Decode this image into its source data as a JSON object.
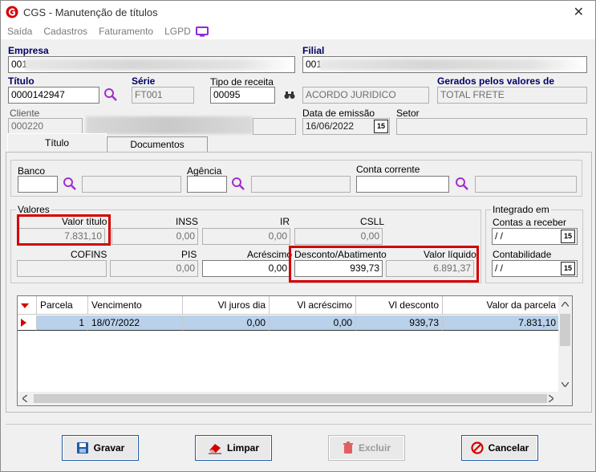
{
  "window": {
    "title": "CGS - Manutenção de títulos",
    "accent": "#d40000"
  },
  "menu": [
    "Saída",
    "Cadastros",
    "Faturamento",
    "LGPD"
  ],
  "empresa": {
    "label": "Empresa",
    "value": "001"
  },
  "filial": {
    "label": "Filial",
    "value": "001"
  },
  "titulo": {
    "label": "Título",
    "value": "0000142947"
  },
  "serie": {
    "label": "Série",
    "value": "FT001"
  },
  "tipo_receita": {
    "label": "Tipo de receita",
    "value": "00095",
    "description": "ACORDO JURIDICO"
  },
  "gerados": {
    "label": "Gerados pelos valores de",
    "value": "TOTAL FRETE"
  },
  "cliente": {
    "label": "Cliente",
    "value": "000220"
  },
  "data_emissao": {
    "label": "Data de emissão",
    "value": "16/06/2022"
  },
  "setor": {
    "label": "Setor",
    "value": ""
  },
  "tabs": [
    "Título",
    "Documentos"
  ],
  "banco": {
    "label": "Banco"
  },
  "agencia": {
    "label": "Agência"
  },
  "conta": {
    "label": "Conta corrente"
  },
  "valores": {
    "title": "Valores",
    "valor_titulo": {
      "label": "Valor título",
      "value": "7.831,10"
    },
    "inss": {
      "label": "INSS",
      "value": "0,00"
    },
    "ir": {
      "label": "IR",
      "value": "0,00"
    },
    "csll": {
      "label": "CSLL",
      "value": "0,00"
    },
    "cofins": {
      "label": "COFINS",
      "value": ""
    },
    "pis": {
      "label": "PIS",
      "value": "0,00"
    },
    "acrescimo": {
      "label": "Acréscimo",
      "value": "0,00"
    },
    "desconto": {
      "label": "Desconto/Abatimento",
      "value": "939,73"
    },
    "liquido": {
      "label": "Valor líquido",
      "value": "6.891,37"
    }
  },
  "integrado": {
    "title": "Integrado em",
    "contas_receber": {
      "label": "Contas a receber",
      "value": " / /"
    },
    "contabilidade": {
      "label": "Contabilidade",
      "value": " / /"
    }
  },
  "grid": {
    "headers": [
      "Parcela",
      "Vencimento",
      "Vl juros dia",
      "Vl acréscimo",
      "Vl desconto",
      "Valor da parcela"
    ],
    "rows": [
      {
        "parcela": "1",
        "vencimento": "18/07/2022",
        "juros": "0,00",
        "acrescimo": "0,00",
        "desconto": "939,73",
        "valor": "7.831,10"
      }
    ]
  },
  "buttons": {
    "gravar": "Gravar",
    "limpar": "Limpar",
    "excluir": "Excluir",
    "cancelar": "Cancelar"
  },
  "calendar_glyph": "15"
}
